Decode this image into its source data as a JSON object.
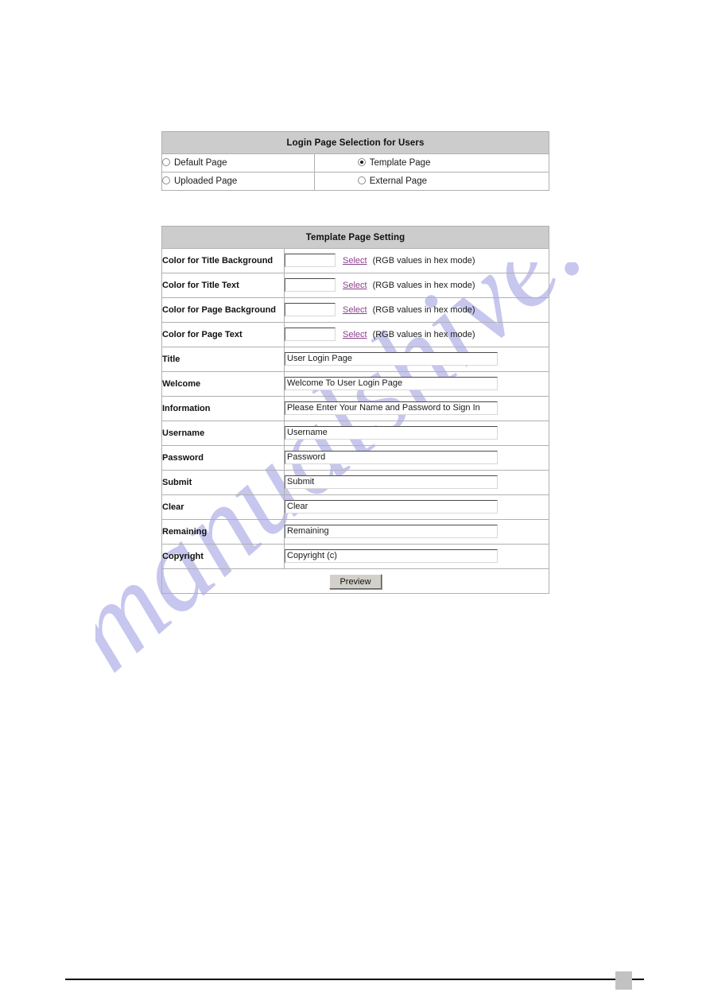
{
  "watermark": {
    "text": "manualshive.com",
    "color": "#c6c6ee"
  },
  "login_selection": {
    "header": "Login Page Selection for Users",
    "options": [
      {
        "label": "Default Page",
        "checked": false,
        "column": "left"
      },
      {
        "label": "Template Page",
        "checked": true,
        "column": "right"
      },
      {
        "label": "Uploaded Page",
        "checked": false,
        "column": "left"
      },
      {
        "label": "External Page",
        "checked": false,
        "column": "right"
      }
    ]
  },
  "template_setting": {
    "header": "Template Page Setting",
    "select_link_label": "Select",
    "hex_hint": "(RGB values in hex mode)",
    "color_rows": [
      {
        "label": "Color for Title Background",
        "value": ""
      },
      {
        "label": "Color for Title Text",
        "value": ""
      },
      {
        "label": "Color for Page Background",
        "value": ""
      },
      {
        "label": "Color for Page Text",
        "value": ""
      }
    ],
    "text_rows": [
      {
        "label": "Title",
        "value": "User Login Page"
      },
      {
        "label": "Welcome",
        "value": "Welcome To User Login Page"
      },
      {
        "label": "Information",
        "value": "Please Enter Your Name and Password to Sign In"
      },
      {
        "label": "Username",
        "value": "Username"
      },
      {
        "label": "Password",
        "value": "Password"
      },
      {
        "label": "Submit",
        "value": "Submit"
      },
      {
        "label": "Clear",
        "value": "Clear"
      },
      {
        "label": "Remaining",
        "value": "Remaining"
      },
      {
        "label": "Copyright",
        "value": "Copyright (c)"
      }
    ],
    "preview_button": "Preview"
  }
}
